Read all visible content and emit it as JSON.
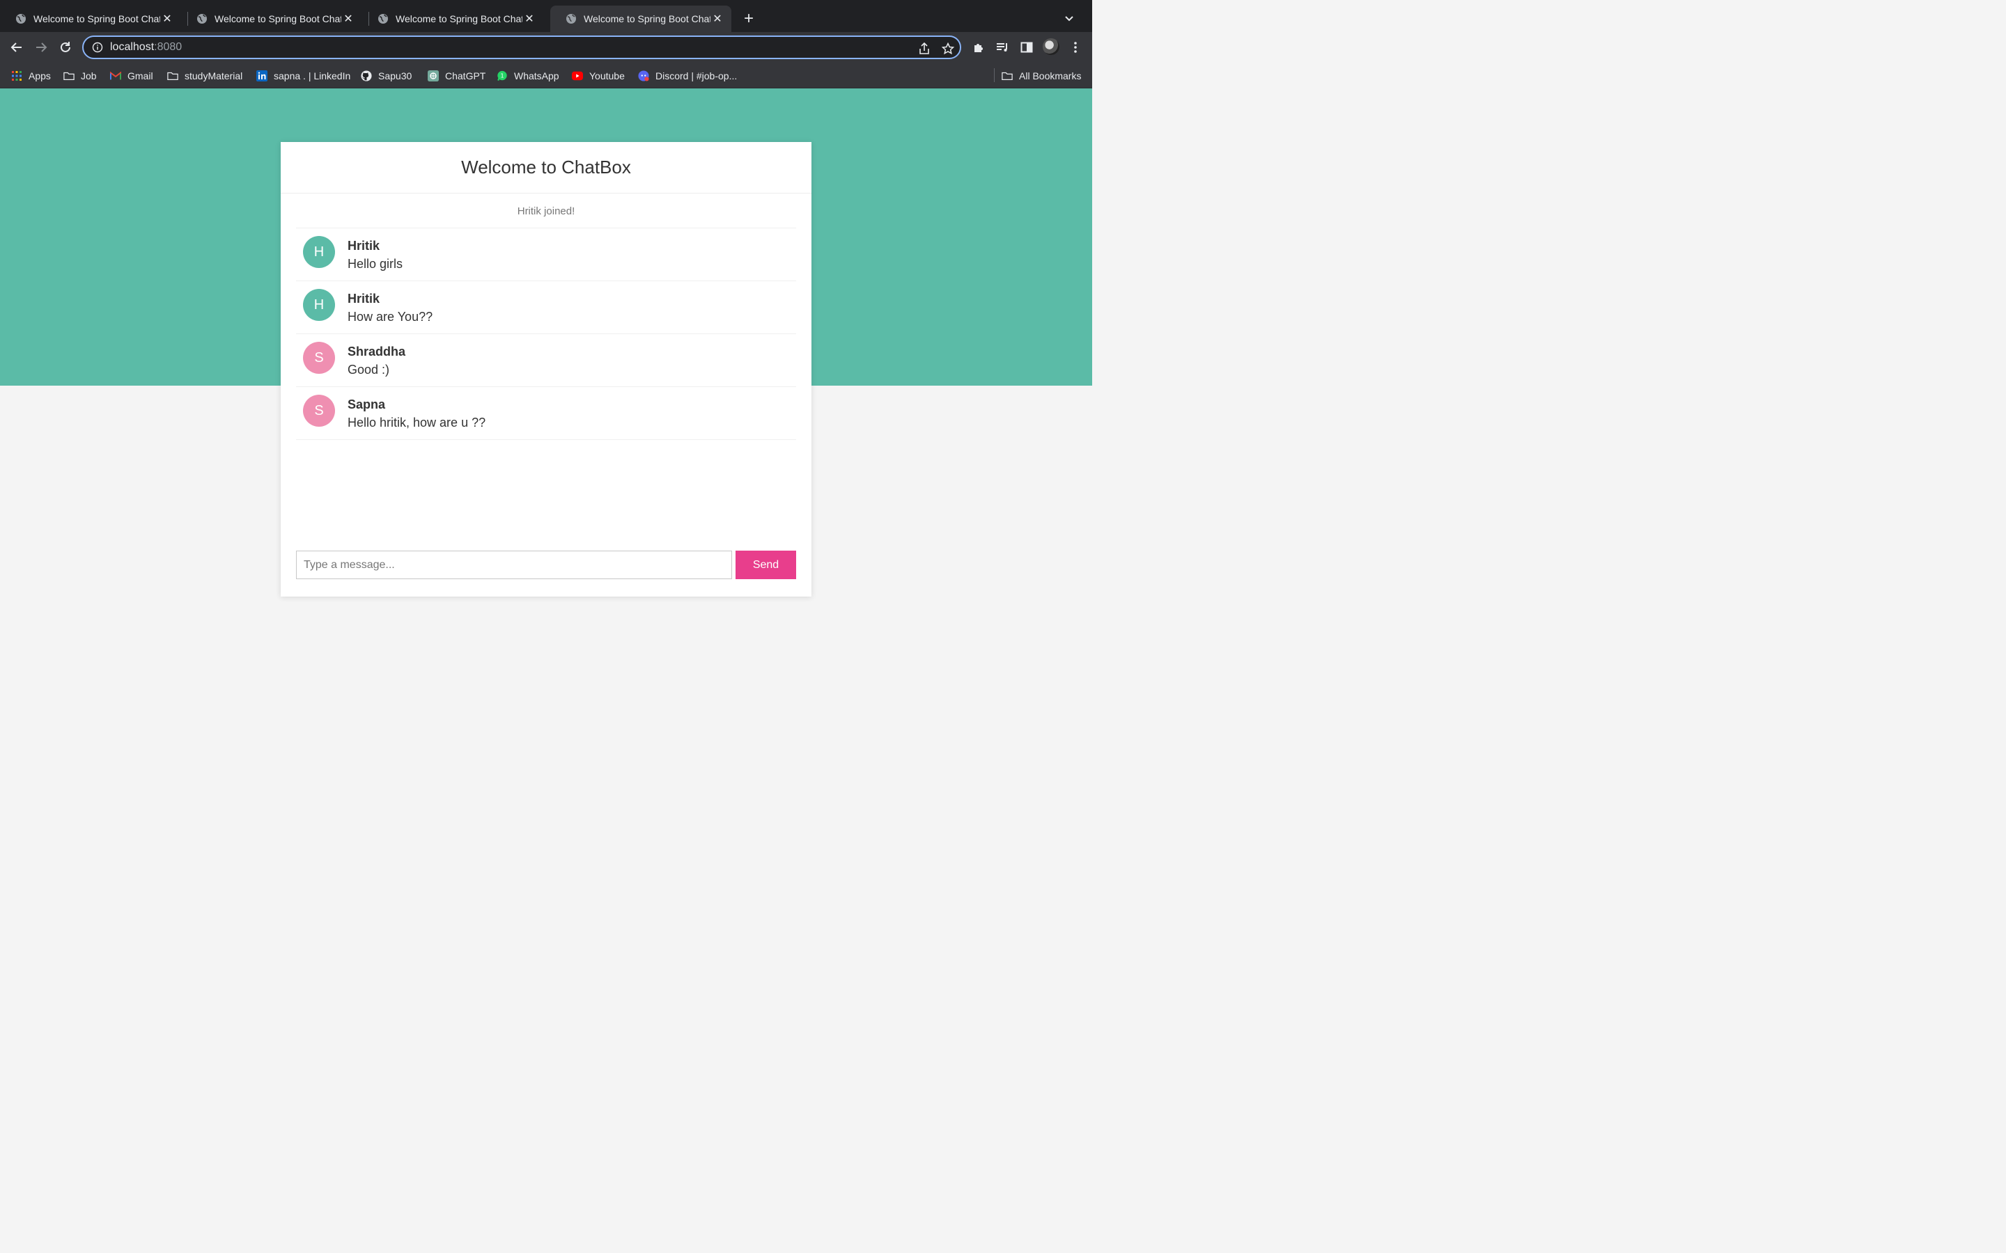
{
  "browser": {
    "tabs": [
      {
        "title": "Welcome to Spring Boot Chat",
        "active": false
      },
      {
        "title": "Welcome to Spring Boot Chat",
        "active": false
      },
      {
        "title": "Welcome to Spring Boot Chat",
        "active": false
      },
      {
        "title": "Welcome to Spring Boot Chat",
        "active": true
      }
    ],
    "address": {
      "host": "localhost",
      "port": ":8080"
    },
    "bookmarks": [
      {
        "label": "Apps",
        "icon": "apps-grid-icon"
      },
      {
        "label": "Job",
        "icon": "folder-icon"
      },
      {
        "label": "Gmail",
        "icon": "gmail-icon"
      },
      {
        "label": "studyMaterial",
        "icon": "folder-icon"
      },
      {
        "label": "sapna . | LinkedIn",
        "icon": "linkedin-icon"
      },
      {
        "label": "Sapu30",
        "icon": "github-icon"
      },
      {
        "label": "ChatGPT",
        "icon": "chatgpt-icon"
      },
      {
        "label": "WhatsApp",
        "icon": "whatsapp-icon"
      },
      {
        "label": "Youtube",
        "icon": "youtube-icon"
      },
      {
        "label": "Discord | #job-op...",
        "icon": "discord-icon"
      }
    ],
    "all_bookmarks": "All Bookmarks"
  },
  "chat": {
    "title": "Welcome to ChatBox",
    "event": "Hritik joined!",
    "messages": [
      {
        "initial": "H",
        "sender": "Hritik",
        "text": "Hello girls",
        "color": "#5bbba7"
      },
      {
        "initial": "H",
        "sender": "Hritik",
        "text": "How are You??",
        "color": "#5bbba7"
      },
      {
        "initial": "S",
        "sender": "Shraddha",
        "text": "Good :)",
        "color": "#ef8fb1"
      },
      {
        "initial": "S",
        "sender": "Sapna",
        "text": "Hello hritik, how are u ??",
        "color": "#ef8fb1"
      }
    ],
    "input": {
      "placeholder": "Type a message...",
      "value": ""
    },
    "send_label": "Send"
  },
  "colors": {
    "header_bg": "#5bbba7",
    "send_button": "#e83e8c",
    "page_bg": "#f4f4f4"
  }
}
